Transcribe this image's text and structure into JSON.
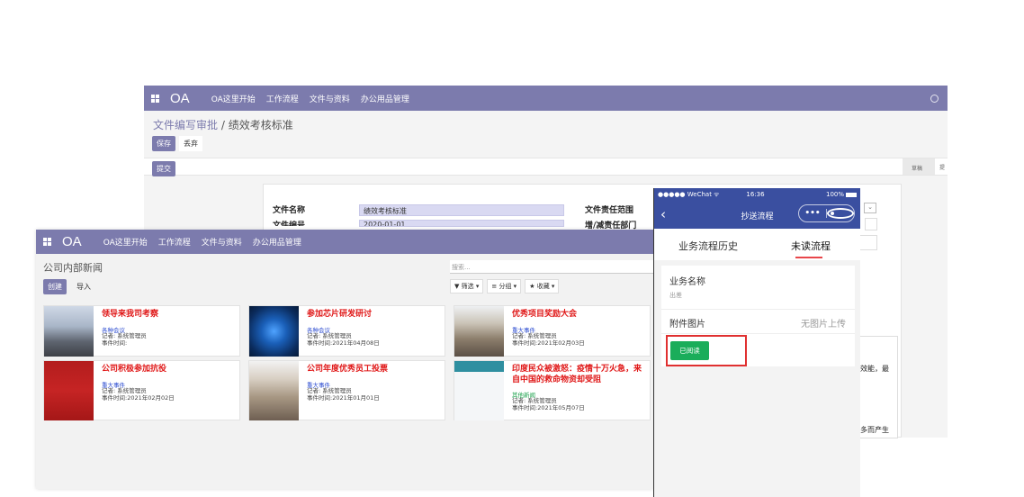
{
  "back_window": {
    "brand": "OA",
    "menu": [
      "OA这里开始",
      "工作流程",
      "文件与资料",
      "办公用品管理"
    ],
    "breadcrumb_parent": "文件编写审批",
    "breadcrumb_sep": " / ",
    "breadcrumb_current": "绩效考核标准",
    "save_label": "保存",
    "discard_label": "丢弃",
    "submit_label": "提交",
    "stage_label": "草稿",
    "stage_next": "提",
    "fields": {
      "file_name_label": "文件名称",
      "file_name_value": "绩效考核标准",
      "file_no_label": "文件编号",
      "file_no_value": "2020-01-01",
      "scope_label": "文件责任范围",
      "dept_label": "增/减责任部门"
    },
    "cut_text_1": "效能，最",
    "cut_text_2": "多而产生"
  },
  "front_window": {
    "brand": "OA",
    "menu": [
      "OA这里开始",
      "工作流程",
      "文件与资料",
      "办公用品管理"
    ],
    "page_title": "公司内部新闻",
    "create_label": "创建",
    "import_label": "导入",
    "search_placeholder": "搜索...",
    "filter_label": "▼ 筛选 ▾",
    "group_label": "≡ 分组 ▾",
    "favorite_label": "★ 收藏 ▾",
    "cards": [
      {
        "title": "领导来我司考察",
        "category": "各种会议",
        "reporter": "记者: 系统管理员",
        "time": "事件时间:"
      },
      {
        "title": "参加芯片研发研讨",
        "category": "各种会议",
        "reporter": "记者: 系统管理员",
        "time": "事件时间:2021年04月08日"
      },
      {
        "title": "优秀项目奖励大会",
        "category": "重大事件",
        "reporter": "记者: 系统管理员",
        "time": "事件时间:2021年02月03日"
      },
      {
        "title": "公司积极参加抗役",
        "category": "重大事件",
        "reporter": "记者: 系统管理员",
        "time": "事件时间:2021年02月02日"
      },
      {
        "title": "公司年度优秀员工投票",
        "category": "重大事件",
        "reporter": "记者: 系统管理员",
        "time": "事件时间:2021年01月01日"
      },
      {
        "title": "印度民众被激怒：疫情十万火急，来自中国的救命物资却受阻",
        "category": "其他新闻",
        "reporter": "记者: 系统管理员",
        "time": "事件时间:2021年05月07日"
      }
    ]
  },
  "phone": {
    "carrier": "●●●●● WeChat",
    "wifi": "ᯤ",
    "time": "16:36",
    "battery": "100%",
    "back_glyph": "‹",
    "title": "抄送流程",
    "menu_dots": "•••",
    "tab_history": "业务流程历史",
    "tab_unread": "未读流程",
    "biz_name_label": "业务名称",
    "biz_name_value": "出差",
    "attach_label": "附件图片",
    "attach_value": "无图片上传",
    "read_button": "已阅读"
  },
  "colors": {
    "header": "#7c7bad",
    "phone_header": "#3a4fa0",
    "read_green": "#1aad5a",
    "title_red": "#e01818"
  }
}
